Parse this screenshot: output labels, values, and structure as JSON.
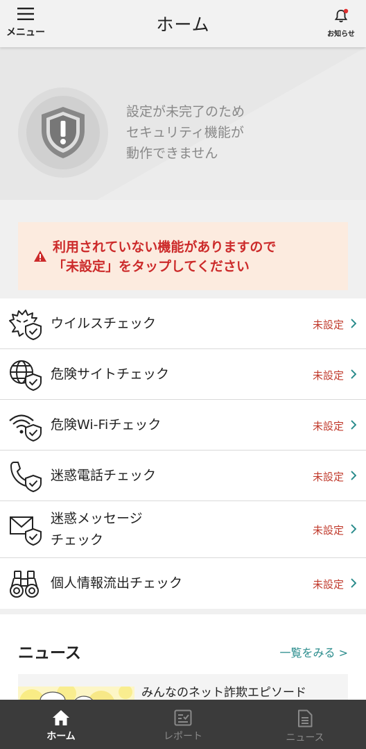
{
  "header": {
    "menu_label": "メニュー",
    "title": "ホーム",
    "notify_label": "お知らせ",
    "notify_badge_color": "#e03030"
  },
  "hero": {
    "line1": "設定が未完了のため",
    "line2": "セキュリティ機能が",
    "line3": "動作できません"
  },
  "warning": {
    "line1": "利用されていない機能がありますので",
    "line2": "「未設定」をタップしてください",
    "color": "#cc2a2a"
  },
  "features": [
    {
      "label": "ウイルスチェック",
      "status": "未設定",
      "icon": "virus-shield-icon"
    },
    {
      "label": "危険サイトチェック",
      "status": "未設定",
      "icon": "globe-shield-icon"
    },
    {
      "label": "危険Wi-Fiチェック",
      "status": "未設定",
      "icon": "wifi-shield-icon"
    },
    {
      "label": "迷惑電話チェック",
      "status": "未設定",
      "icon": "phone-shield-icon"
    },
    {
      "label_line1": "迷惑メッセージ",
      "label_line2": "チェック",
      "status": "未設定",
      "icon": "mail-shield-icon"
    },
    {
      "label": "個人情報流出チェック",
      "status": "未設定",
      "icon": "binoculars-icon"
    }
  ],
  "news": {
    "title": "ニュース",
    "more": "一覧をみる >",
    "card_title": "みんなのネット詐欺エピソード"
  },
  "bottom_nav": [
    {
      "label": "ホーム",
      "icon": "home-icon",
      "active": true
    },
    {
      "label": "レポート",
      "icon": "report-icon",
      "active": false
    },
    {
      "label": "ニュース",
      "icon": "news-icon",
      "active": false
    }
  ],
  "colors": {
    "status_red": "#c0392b",
    "link_teal": "#2a8c8c",
    "nav_bg": "#3b3b3b"
  }
}
